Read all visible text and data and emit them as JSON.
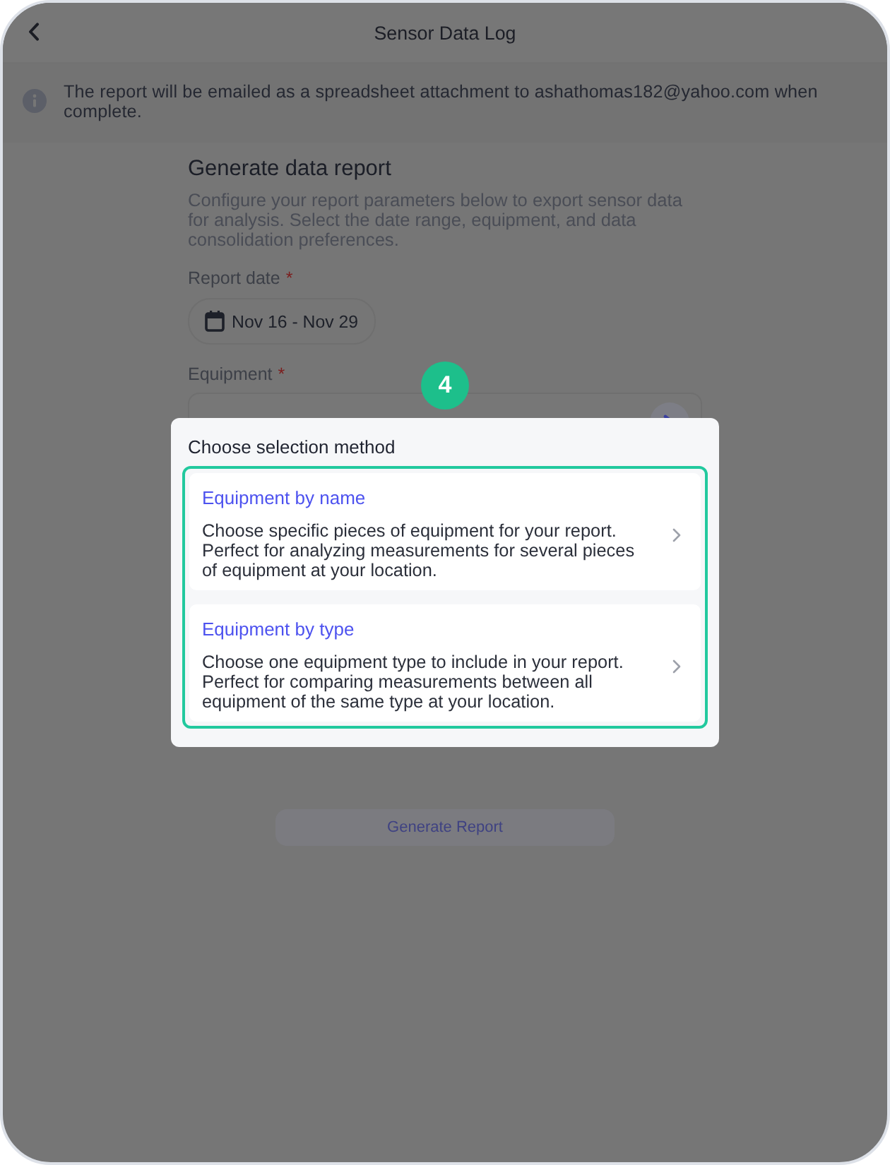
{
  "window": {
    "title": "Sensor Data Log"
  },
  "banner": {
    "text": "The report will be emailed as a spreadsheet attachment to ashathomas182@yahoo.com when complete."
  },
  "form": {
    "heading": "Generate data report",
    "description": "Configure your report parameters below to export sensor data for analysis. Select the date range, equipment, and data consolidation preferences.",
    "fields": [
      {
        "kind": "date",
        "label": "Report date",
        "required_mark": "*",
        "value": "Nov 16 - Nov 29"
      },
      {
        "kind": "select",
        "label": "Equipment",
        "required_mark": "*"
      }
    ]
  },
  "step_marker": {
    "label": "4"
  },
  "dialog": {
    "title": "Choose selection method",
    "highlighted": true,
    "options": [
      {
        "title": "Equipment by name",
        "description": "Choose specific pieces of equipment for your report. Perfect for analyzing measurements for several pieces of equipment at your location."
      },
      {
        "title": "Equipment by type",
        "description": "Choose one equipment type to include in your report. Perfect for comparing measurements between all equipment of the same type at your location."
      }
    ]
  },
  "submit": {
    "label": "Generate Report",
    "disabled": true
  }
}
